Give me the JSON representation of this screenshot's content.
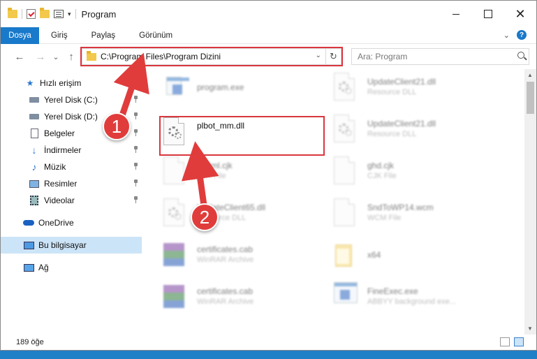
{
  "window": {
    "title": "Program",
    "close_glyph": "✕"
  },
  "ribbon": {
    "file_tab": "Dosya",
    "tabs": [
      "Giriş",
      "Paylaş",
      "Görünüm"
    ],
    "help_glyph": "?"
  },
  "navigation": {
    "back_glyph": "←",
    "forward_glyph": "→",
    "recent_glyph": "⌄",
    "up_glyph": "↑",
    "address_path": "C:\\Program Files\\Program Dizini",
    "refresh_glyph": "↻",
    "search_placeholder": "Ara: Program"
  },
  "sidebar": {
    "items": [
      {
        "label": "Hızlı erişim",
        "icon": "star-icon"
      },
      {
        "label": "Yerel Disk (C:)",
        "icon": "drive-icon"
      },
      {
        "label": "Yerel Disk (D:)",
        "icon": "drive-icon"
      },
      {
        "label": "Belgeler",
        "icon": "documents-icon"
      },
      {
        "label": "İndirmeler",
        "icon": "download-icon"
      },
      {
        "label": "Müzik",
        "icon": "music-icon"
      },
      {
        "label": "Resimler",
        "icon": "pictures-icon"
      },
      {
        "label": "Videolar",
        "icon": "video-icon"
      },
      {
        "label": "OneDrive",
        "icon": "cloud-icon"
      },
      {
        "label": "Bu bilgisayar",
        "icon": "computer-icon"
      },
      {
        "label": "Ağ",
        "icon": "network-icon"
      }
    ]
  },
  "files": [
    {
      "name": "program.exe",
      "desc": ""
    },
    {
      "name": "UpdateClient21.dll",
      "desc": "Resource DLL"
    },
    {
      "name": "plbot_mm.dll",
      "desc": ""
    },
    {
      "name": "UpdateClient21.dll",
      "desc": "Resource DLL"
    },
    {
      "name": "pfhtml.cjk",
      "desc": "CJK File"
    },
    {
      "name": "ghd.cjk",
      "desc": "CJK File"
    },
    {
      "name": "UpdateClient65.dll",
      "desc": "Resource DLL"
    },
    {
      "name": "SndToWP14.wcm",
      "desc": "WCM File"
    },
    {
      "name": "certificates.cab",
      "desc": "WinRAR Archive"
    },
    {
      "name": "x64",
      "desc": ""
    },
    {
      "name": "certificates.cab",
      "desc": "WinRAR Archive"
    },
    {
      "name": "FineExec.exe",
      "desc": "ABBYY background exe..."
    }
  ],
  "status": {
    "item_count": "189 öğe"
  },
  "annotations": {
    "step1": "1",
    "step2": "2"
  },
  "colors": {
    "accent": "#1979ca",
    "highlight": "#d9363e",
    "badge": "#e03c3c",
    "selection": "#cce4f7"
  }
}
